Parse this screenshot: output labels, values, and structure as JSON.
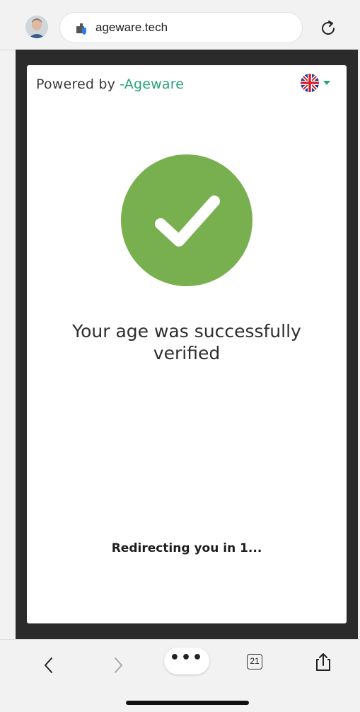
{
  "browser": {
    "url": "ageware.tech",
    "tab_count": "21",
    "more_label": "•••"
  },
  "page": {
    "powered_by": "Powered by",
    "brand": "-Ageware",
    "language": "English (UK)",
    "message_line1": "Your age was successfully",
    "message_line2": "verified",
    "redirect": "Redirecting you in 1..."
  },
  "colors": {
    "success_green": "#79b04f",
    "brand_green": "#27a37a",
    "frame": "#2b2b2b"
  },
  "icons": [
    "avatar",
    "site-shield-icon",
    "reload-icon",
    "uk-flag-icon",
    "caret-down-icon",
    "checkmark-icon",
    "back-icon",
    "forward-icon",
    "share-icon"
  ]
}
